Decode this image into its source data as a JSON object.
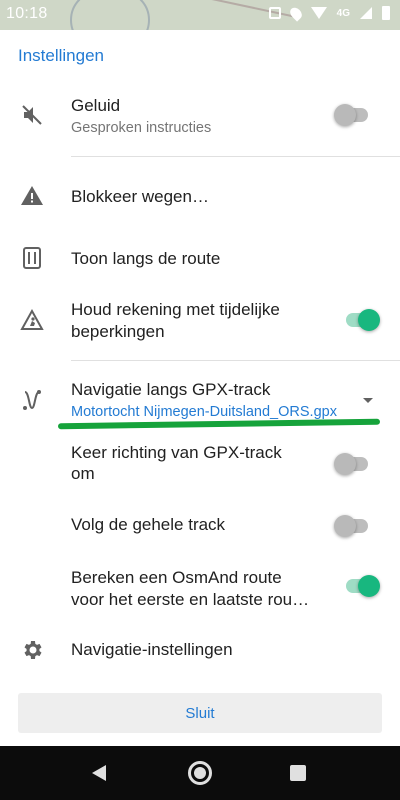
{
  "status_bar": {
    "time": "10:18",
    "network": "4G"
  },
  "header": {
    "title": "Instellingen"
  },
  "rows": {
    "sound": {
      "title": "Geluid",
      "subtitle": "Gesproken instructies",
      "toggle": "off",
      "icon": "sound-off-icon"
    },
    "avoid_roads": {
      "title": "Blokkeer wegen…",
      "icon": "warning-icon"
    },
    "show_along_route": {
      "title": "Toon langs de route",
      "icon": "restaurant-icon"
    },
    "temporary_restrictions": {
      "title_line1": "Houd rekening met tijdelijke",
      "title_line2": "beperkingen",
      "toggle": "on",
      "icon": "road-works-icon"
    },
    "gpx_navigation": {
      "title": "Navigatie langs GPX-track",
      "value": "Motortocht Nijmegen-Duitsland_ORS.gpx",
      "icon": "gpx-route-icon"
    },
    "reverse_gpx": {
      "title_line1": "Keer richting van GPX-track",
      "title_line2": "om",
      "toggle": "off"
    },
    "follow_whole_track": {
      "title": "Volg de gehele track",
      "toggle": "off"
    },
    "osmand_route": {
      "title_line1": "Bereken een OsmAnd route",
      "title_line2": "voor het eerste en laatste rou…",
      "toggle": "on"
    },
    "navigation_settings": {
      "title": "Navigatie-instellingen",
      "icon": "gear-icon"
    }
  },
  "close_button": {
    "label": "Sluit"
  },
  "colors": {
    "accent": "#237bd3",
    "toggle_on": "#18b77f",
    "highlight_underline": "#16a33b"
  }
}
